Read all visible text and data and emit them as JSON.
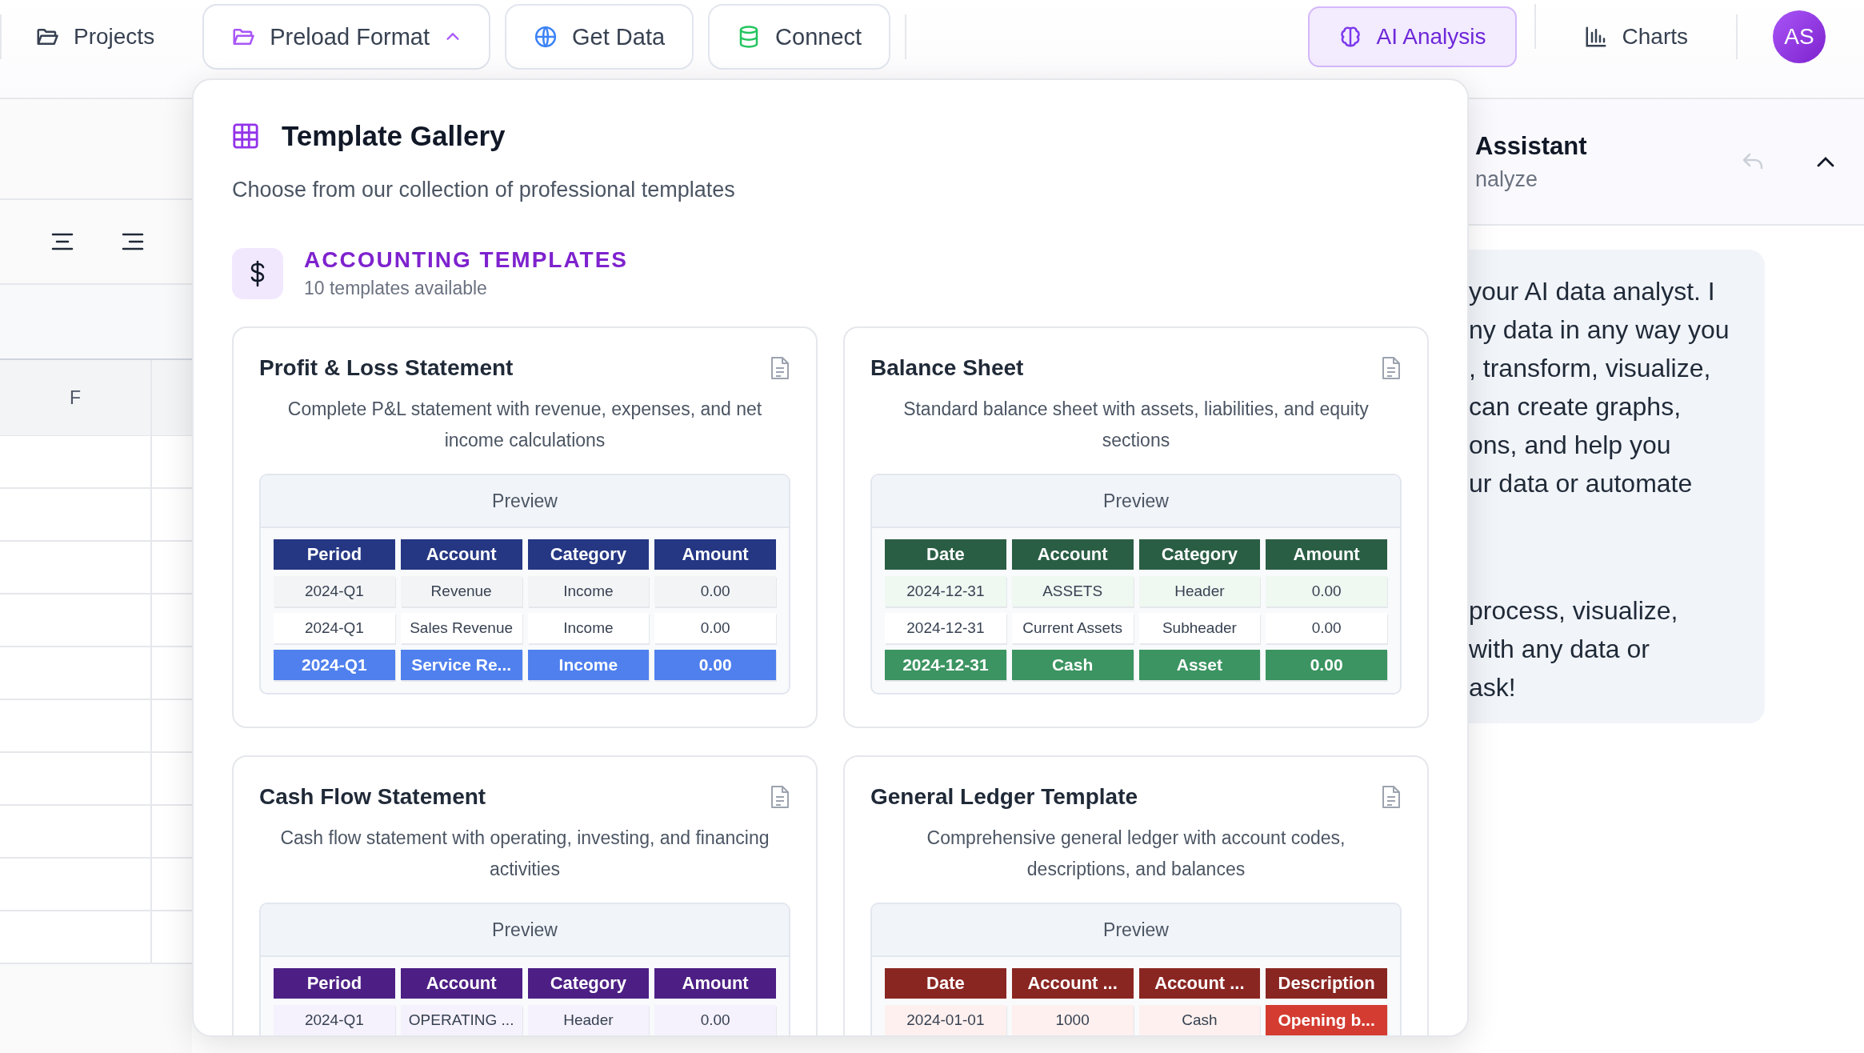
{
  "nav": {
    "left": [
      {
        "kind": "plain",
        "label": "Projects"
      },
      {
        "kind": "dropdown",
        "label": "Preload Format",
        "expanded": true
      },
      {
        "kind": "button",
        "label": "Get Data"
      },
      {
        "kind": "button",
        "label": "Connect"
      }
    ],
    "right": [
      {
        "label": "AI Analysis",
        "selected": true
      },
      {
        "label": "Charts",
        "selected": false
      }
    ],
    "avatar": "AS"
  },
  "sheet": {
    "column_header": "F"
  },
  "assistant": {
    "title": "Assistant",
    "subtitle": "nalyze",
    "message_paragraphs": [
      [
        "your AI data analyst. I",
        "ny data in any way you",
        ", transform, visualize,",
        "can create graphs,",
        "ons, and help you",
        "ur data or automate"
      ],
      [
        "process, visualize,",
        "with any data or",
        "ask!"
      ]
    ]
  },
  "gallery": {
    "title": "Template Gallery",
    "subtitle": "Choose from our collection of professional templates",
    "category": {
      "title": "ACCOUNTING TEMPLATES",
      "count": "10 templates available"
    },
    "templates": [
      {
        "title": "Profit & Loss Statement",
        "description": "Complete P&L statement with revenue, expenses, and net income calculations",
        "preview_label": "Preview",
        "columns": [
          "Period",
          "Account",
          "Category",
          "Amount"
        ],
        "rows": [
          [
            {
              "text": "2024-Q1",
              "highlighted": false
            },
            {
              "text": "Revenue",
              "highlighted": false
            },
            {
              "text": "Income",
              "highlighted": false
            },
            {
              "text": "0.00",
              "highlighted": false
            }
          ],
          [
            {
              "text": "2024-Q1",
              "highlighted": false
            },
            {
              "text": "Sales Revenue",
              "highlighted": false
            },
            {
              "text": "Income",
              "highlighted": false
            },
            {
              "text": "0.00",
              "highlighted": false
            }
          ],
          [
            {
              "text": "2024-Q1",
              "highlighted": true
            },
            {
              "text": "Service Re...",
              "highlighted": true
            },
            {
              "text": "Income",
              "highlighted": true
            },
            {
              "text": "0.00",
              "highlighted": true
            }
          ]
        ]
      },
      {
        "title": "Balance Sheet",
        "description": "Standard balance sheet with assets, liabilities, and equity sections",
        "preview_label": "Preview",
        "columns": [
          "Date",
          "Account",
          "Category",
          "Amount"
        ],
        "rows": [
          [
            {
              "text": "2024-12-31",
              "highlighted": false
            },
            {
              "text": "ASSETS",
              "highlighted": false
            },
            {
              "text": "Header",
              "highlighted": false
            },
            {
              "text": "0.00",
              "highlighted": false
            }
          ],
          [
            {
              "text": "2024-12-31",
              "highlighted": false
            },
            {
              "text": "Current Assets",
              "highlighted": false
            },
            {
              "text": "Subheader",
              "highlighted": false
            },
            {
              "text": "0.00",
              "highlighted": false
            }
          ],
          [
            {
              "text": "2024-12-31",
              "highlighted": true
            },
            {
              "text": "Cash",
              "highlighted": true
            },
            {
              "text": "Asset",
              "highlighted": true
            },
            {
              "text": "0.00",
              "highlighted": true
            }
          ]
        ]
      },
      {
        "title": "Cash Flow Statement",
        "description": "Cash flow statement with operating, investing, and financing activities",
        "preview_label": "Preview",
        "columns": [
          "Period",
          "Account",
          "Category",
          "Amount"
        ],
        "rows": [
          [
            {
              "text": "2024-Q1",
              "highlighted": false
            },
            {
              "text": "OPERATING ...",
              "highlighted": false
            },
            {
              "text": "Header",
              "highlighted": false
            },
            {
              "text": "0.00",
              "highlighted": false
            }
          ]
        ]
      },
      {
        "title": "General Ledger Template",
        "description": "Comprehensive general ledger with account codes, descriptions, and balances",
        "preview_label": "Preview",
        "columns": [
          "Date",
          "Account ...",
          "Account ...",
          "Description"
        ],
        "rows": [
          [
            {
              "text": "2024-01-01",
              "highlighted": false
            },
            {
              "text": "1000",
              "highlighted": false
            },
            {
              "text": "Cash",
              "highlighted": false
            },
            {
              "text": "Opening b...",
              "highlighted": true
            }
          ]
        ]
      }
    ]
  }
}
